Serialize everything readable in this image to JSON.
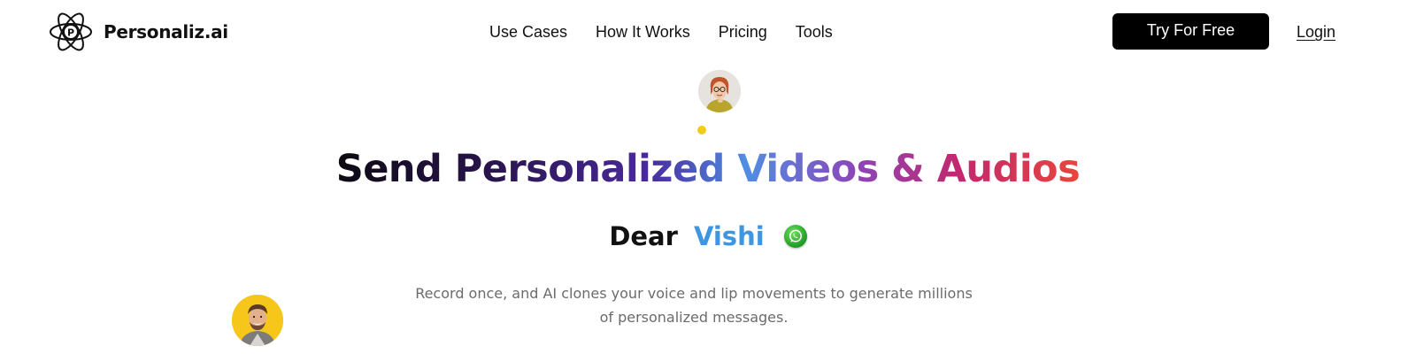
{
  "header": {
    "logo_text": "Personaliz.ai",
    "logo_icon": "atom-p-icon",
    "nav": [
      {
        "label": "Use Cases"
      },
      {
        "label": "How It Works"
      },
      {
        "label": "Pricing"
      },
      {
        "label": "Tools"
      }
    ],
    "cta_label": "Try For Free",
    "login_label": "Login"
  },
  "hero": {
    "headline_part1": "Send Personalized Videos & Audios",
    "dear": "Dear",
    "name": "Vishi",
    "channel_icon": "whatsapp-icon",
    "subtitle_line1": "Record once, and AI clones your voice and lip movements to generate millions",
    "subtitle_line2": "of personalized messages."
  },
  "colors": {
    "cta_bg": "#000000",
    "name_color": "#3f96e0",
    "accent_yellow": "#f3cc1b",
    "gradient": [
      "#0c0a12",
      "#2b1550",
      "#4a2a9c",
      "#4f8ee3",
      "#8c45b8",
      "#c2286e",
      "#e9463b"
    ]
  }
}
